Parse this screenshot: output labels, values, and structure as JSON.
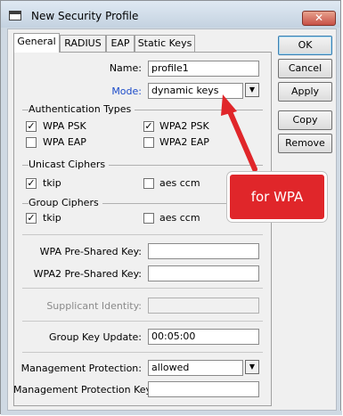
{
  "window": {
    "title": "New Security Profile",
    "close_glyph": "✕",
    "icon": "window-icon"
  },
  "tabs": [
    {
      "label": "General",
      "active": true
    },
    {
      "label": "RADIUS",
      "active": false
    },
    {
      "label": "EAP",
      "active": false
    },
    {
      "label": "Static Keys",
      "active": false
    }
  ],
  "buttons": {
    "ok": "OK",
    "cancel": "Cancel",
    "apply": "Apply",
    "copy": "Copy",
    "remove": "Remove"
  },
  "form": {
    "name_label": "Name:",
    "name_value": "profile1",
    "mode_label": "Mode:",
    "mode_value": "dynamic keys",
    "auth_types_title": "Authentication Types",
    "wpa_psk": "WPA PSK",
    "wpa2_psk": "WPA2 PSK",
    "wpa_eap": "WPA EAP",
    "wpa2_eap": "WPA2 EAP",
    "unicast_title": "Unicast Ciphers",
    "group_title": "Group Ciphers",
    "tkip": "tkip",
    "aes_ccm": "aes ccm",
    "wpa_psk_key_label": "WPA Pre-Shared Key:",
    "wpa_psk_key_value": "",
    "wpa2_psk_key_label": "WPA2 Pre-Shared Key:",
    "wpa2_psk_key_value": "",
    "supplicant_label": "Supplicant Identity:",
    "supplicant_value": "",
    "group_key_label": "Group Key Update:",
    "group_key_value": "00:05:00",
    "mgmt_prot_label": "Management Protection:",
    "mgmt_prot_value": "allowed",
    "mgmt_key_label": "Management Protection Key:",
    "mgmt_key_value": ""
  },
  "checks": {
    "wpa_psk": true,
    "wpa2_psk": true,
    "wpa_eap": false,
    "wpa2_eap": false,
    "unicast_tkip": true,
    "unicast_aes": false,
    "group_tkip": true,
    "group_aes": false
  },
  "annotation": {
    "text": "for WPA",
    "color": "#e0262a"
  }
}
